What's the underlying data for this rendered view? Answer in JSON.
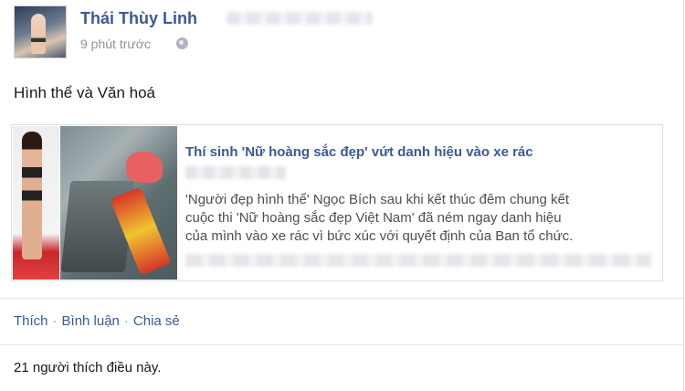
{
  "post": {
    "author": "Thái Thùy Linh",
    "timestamp": "9 phút trước",
    "privacy_icon": "globe-icon",
    "status_text": "Hình thể và Văn hoá"
  },
  "link_preview": {
    "title": "Thí sinh 'Nữ hoàng sắc đẹp' vứt danh hiệu vào xe rác",
    "description_lines": [
      "'Người đẹp hình thể' Ngọc Bích sau khi kết thúc đêm chung kết",
      "cuộc thi 'Nữ hoàng sắc đẹp Việt Nam' đã ném ngay danh hiệu",
      "của mình vào xe rác vì bức xúc với quyết định của Ban tổ chức."
    ]
  },
  "actions": {
    "like_label": "Thích",
    "comment_label": "Bình luận",
    "share_label": "Chia sẻ",
    "separator": "·"
  },
  "likes_summary": "21 người thích điều này.",
  "colors": {
    "link_blue": "#3b5998",
    "meta_gray": "#90949c"
  }
}
